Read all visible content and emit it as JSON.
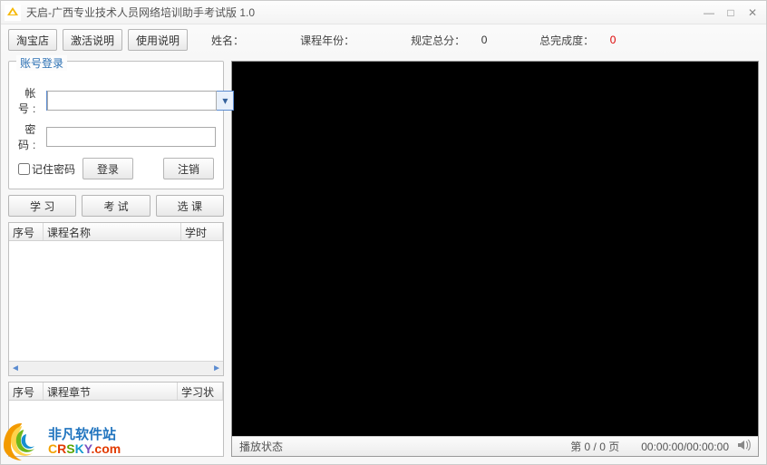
{
  "title": "天启-广西专业技术人员网络培训助手考试版 1.0",
  "toolbar": {
    "taobao": "淘宝店",
    "activate": "激活说明",
    "usage": "使用说明"
  },
  "stats": {
    "name_label": "姓名：",
    "name_value": "",
    "year_label": "课程年份：",
    "year_value": "",
    "total_label": "规定总分：",
    "total_value": "0",
    "done_label": "总完成度：",
    "done_value": "0"
  },
  "login": {
    "group_title": "账号登录",
    "account_label": "帐 号:",
    "password_label": "密 码:",
    "account_value": "",
    "password_value": "",
    "remember": "记住密码",
    "login_btn": "登录",
    "logout_btn": "注销"
  },
  "nav": {
    "study": "学 习",
    "exam": "考 试",
    "choose": "选 课"
  },
  "list1": {
    "col_seq": "序号",
    "col_name": "课程名称",
    "col_hour": "学时"
  },
  "list2": {
    "col_seq": "序号",
    "col_chap": "课程章节",
    "col_stat": "学习状"
  },
  "status": {
    "play_state": "播放状态",
    "page": "第  0 / 0 页",
    "time": "00:00:00/00:00:00"
  },
  "watermark": {
    "line1": "非凡软件站",
    "line2": "CRSKY.com"
  }
}
